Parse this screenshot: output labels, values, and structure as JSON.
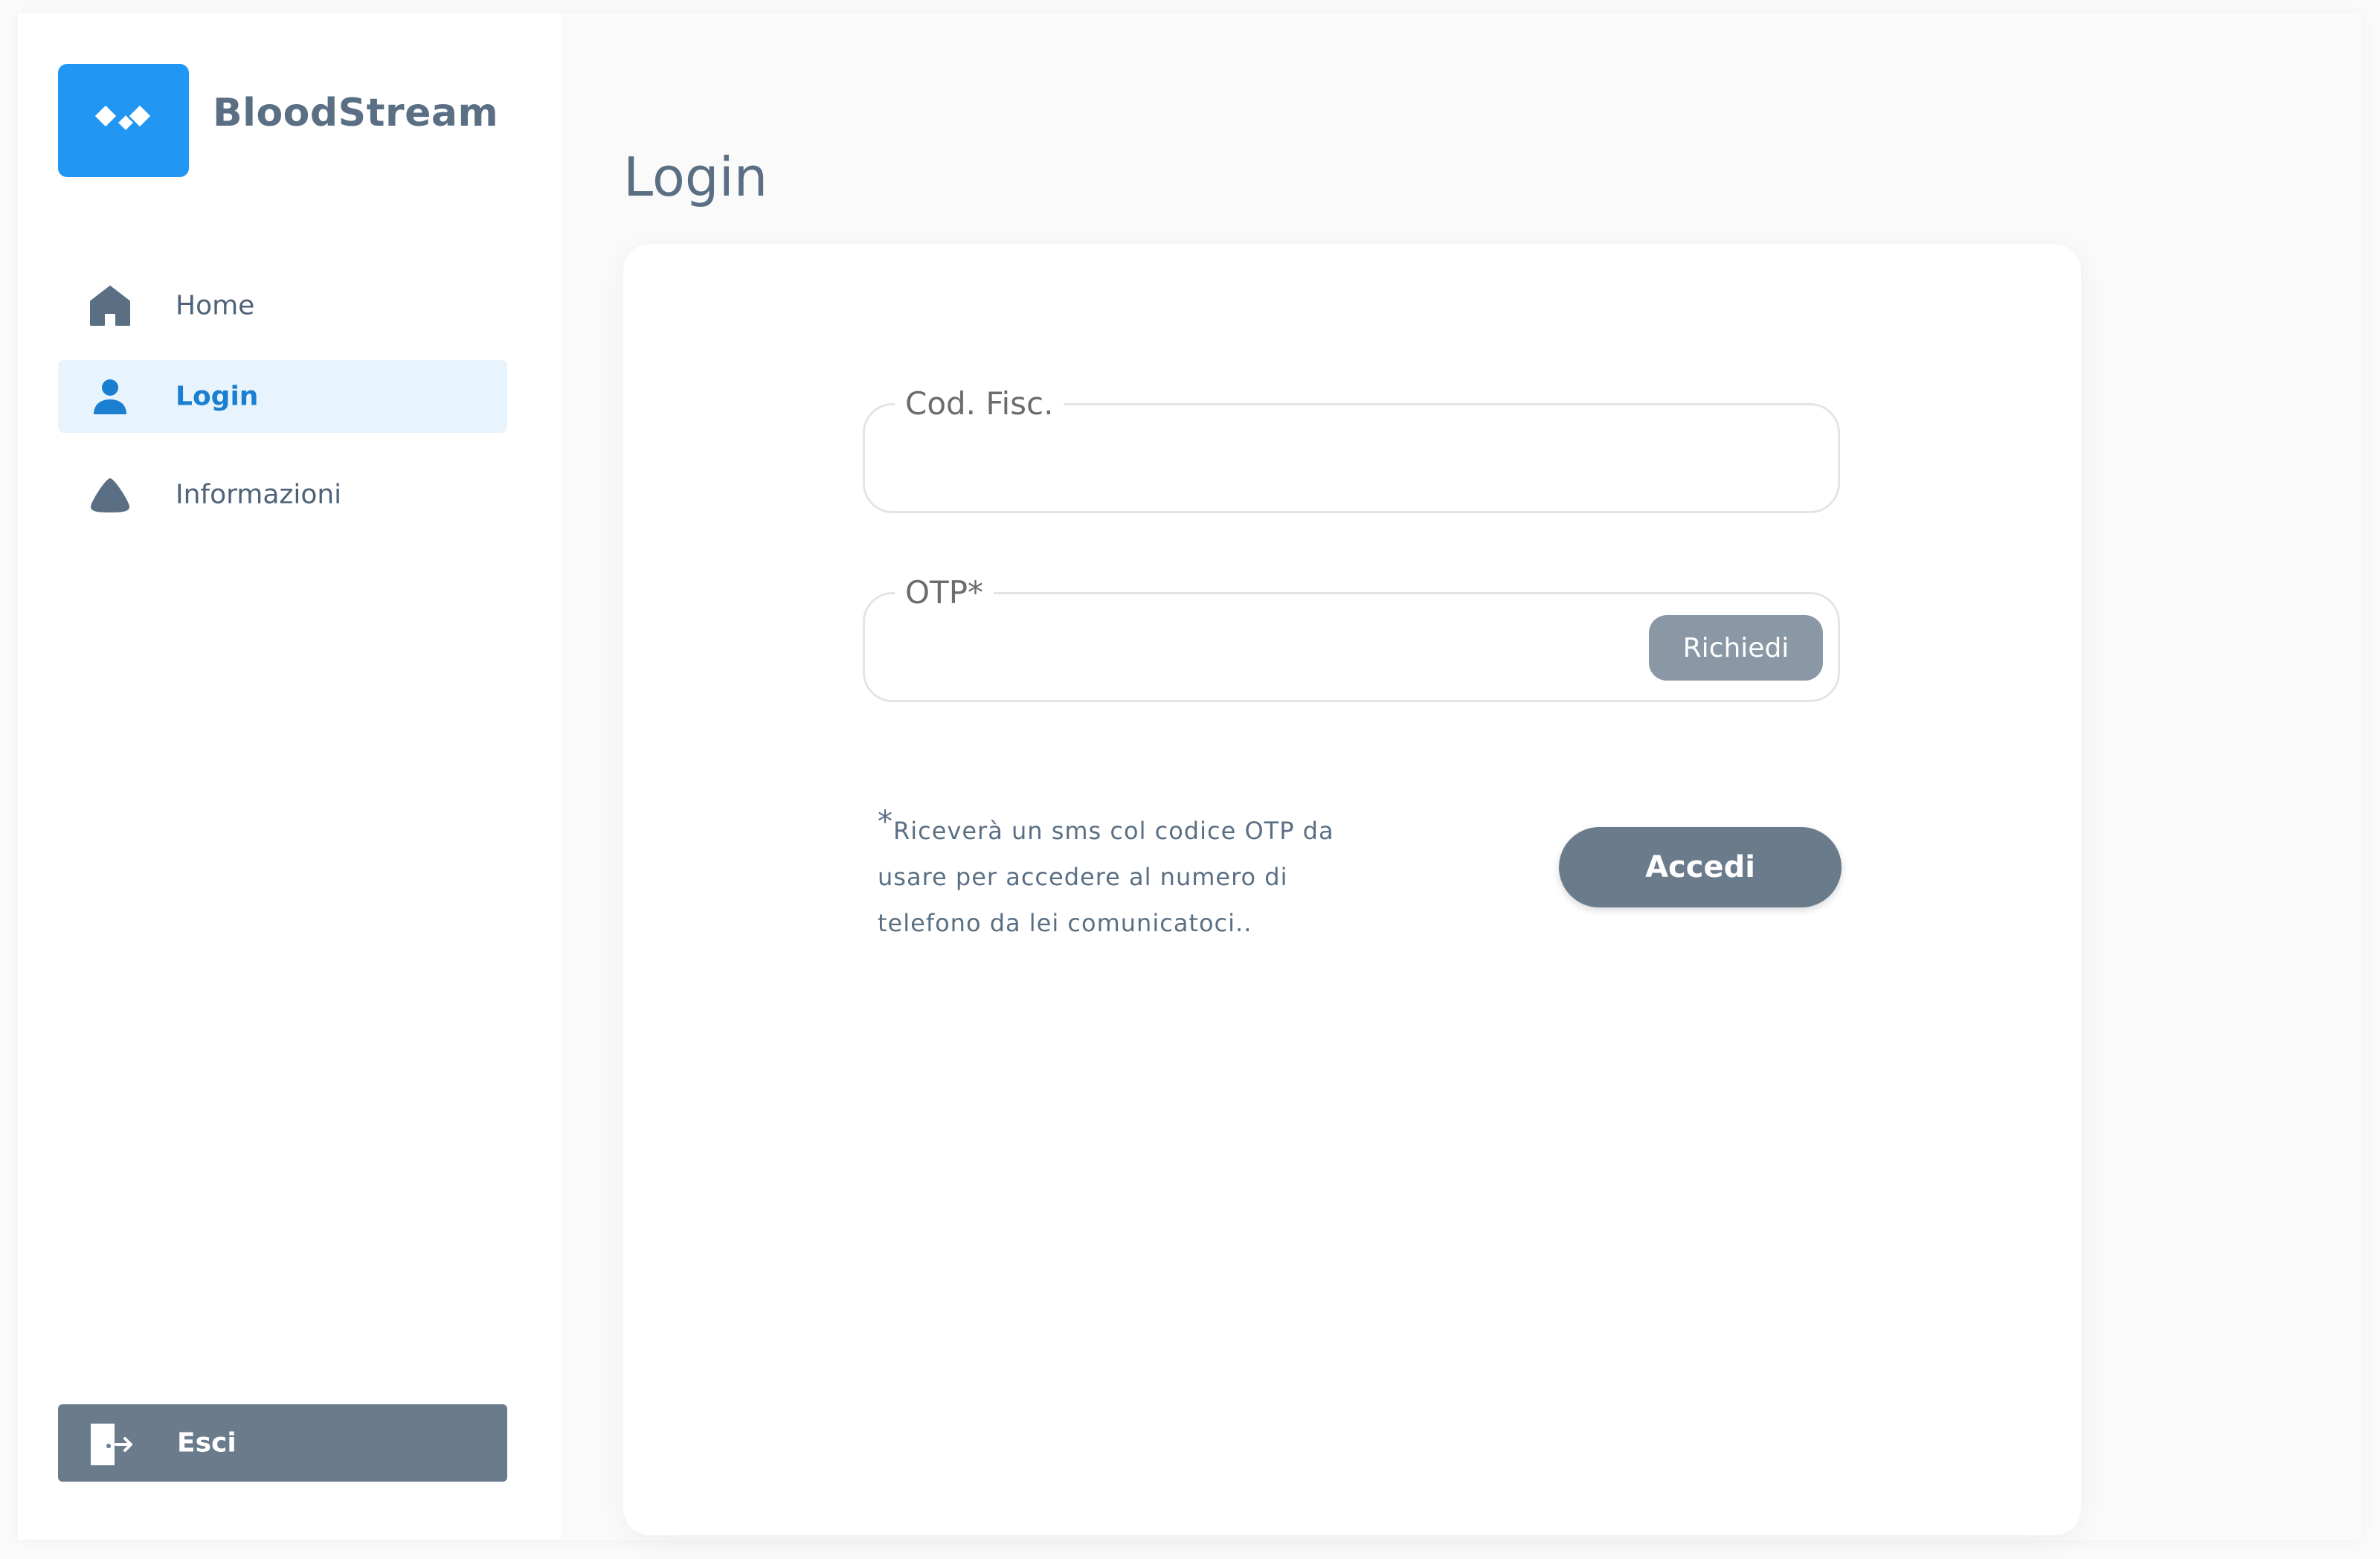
{
  "app": {
    "brand": "BloodStream"
  },
  "sidebar": {
    "items": [
      {
        "label": "Home",
        "icon": "home-icon",
        "active": false
      },
      {
        "label": "Login",
        "icon": "user-icon",
        "active": true
      },
      {
        "label": "Informazioni",
        "icon": "info-triangle-icon",
        "active": false
      }
    ],
    "exit": {
      "label": "Esci",
      "icon": "logout-icon"
    }
  },
  "main": {
    "title": "Login",
    "form": {
      "codfisc": {
        "label": "Cod. Fisc.",
        "value": ""
      },
      "otp": {
        "label": "OTP*",
        "value": "",
        "request_label": "Richiedi"
      },
      "note_asterisk": "*",
      "note": "Riceverà un sms col codice OTP da usare per accedere al numero di telefono da lei comunicatoci..",
      "submit_label": "Accedi"
    }
  },
  "colors": {
    "brand_blue": "#2196f3",
    "active_blue": "#1a7fd1",
    "active_bg": "#e8f4fd",
    "slate": "#6a7b8c",
    "text": "#5b6f84"
  }
}
